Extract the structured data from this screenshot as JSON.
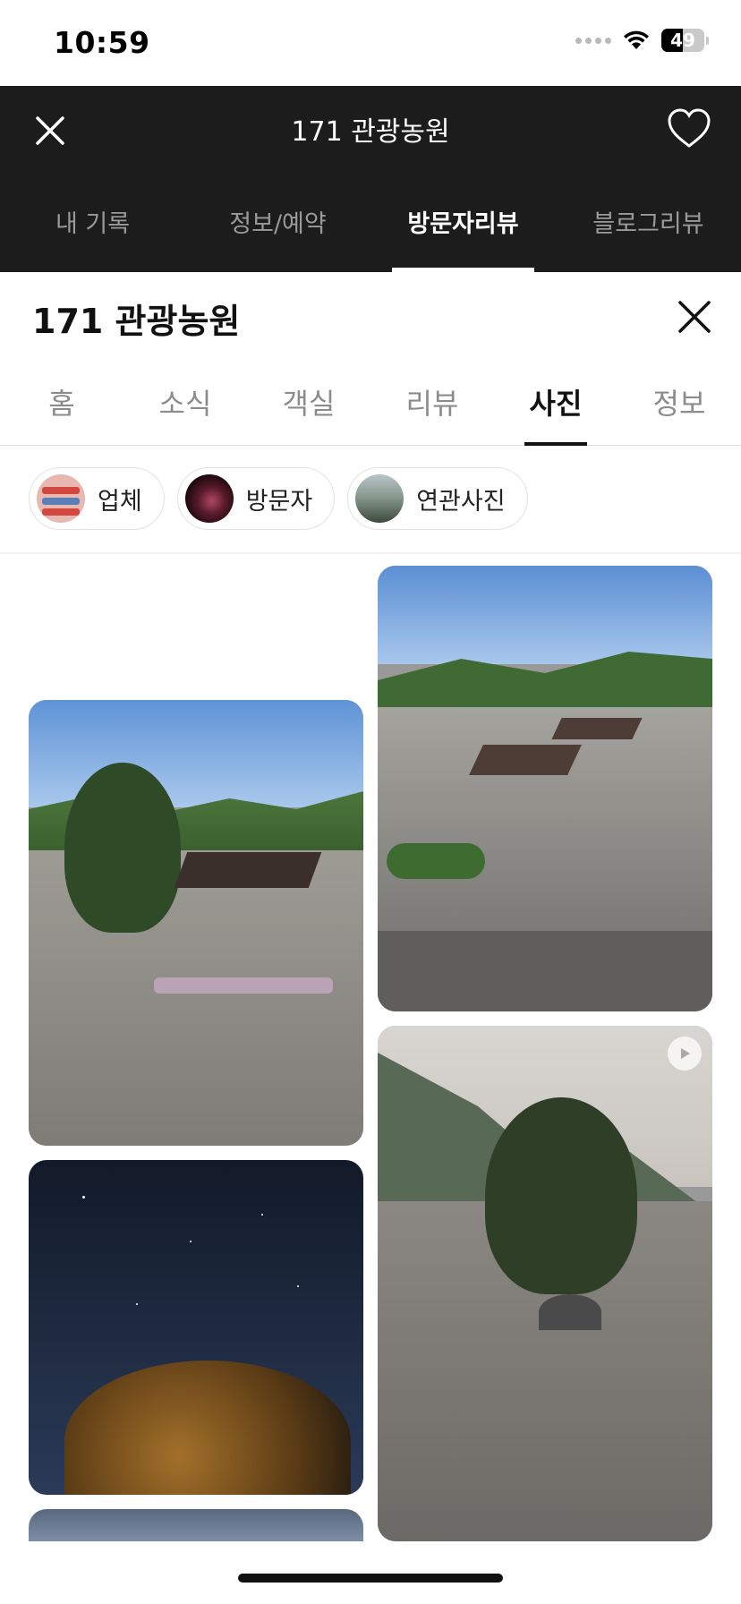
{
  "status": {
    "time": "10:59",
    "battery": "49",
    "battery_level": 0.49
  },
  "header": {
    "title": "171 관광농원",
    "tabs": [
      {
        "label": "내 기록"
      },
      {
        "label": "정보/예약"
      },
      {
        "label": "방문자리뷰"
      },
      {
        "label": "블로그리뷰"
      }
    ],
    "active_tab": 2
  },
  "place": {
    "title": "171 관광농원",
    "tabs": [
      {
        "label": "홈"
      },
      {
        "label": "소식"
      },
      {
        "label": "객실"
      },
      {
        "label": "리뷰"
      },
      {
        "label": "사진"
      },
      {
        "label": "정보"
      }
    ],
    "active_tab": 4
  },
  "filters": [
    {
      "label": "업체"
    },
    {
      "label": "방문자"
    },
    {
      "label": "연관사진"
    }
  ],
  "photos": [
    {
      "name": "campsite-photo-trees",
      "type": "image"
    },
    {
      "name": "campsite-photo-decks",
      "type": "image"
    },
    {
      "name": "night-sky-photo",
      "type": "image"
    },
    {
      "name": "campsite-video",
      "type": "video"
    },
    {
      "name": "photo-partial",
      "type": "image"
    }
  ],
  "colors": {
    "header_bg": "#1c1c1c",
    "active_text": "#111111",
    "inactive_text": "#8c8c8c"
  }
}
